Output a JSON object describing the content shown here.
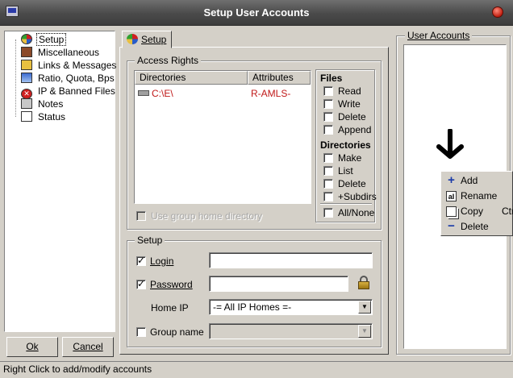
{
  "window": {
    "title": "Setup User Accounts"
  },
  "tree": {
    "items": [
      {
        "label": "Setup",
        "icon": "setup-icon",
        "color": "#2a5cc8"
      },
      {
        "label": "Miscellaneous",
        "icon": "book-icon",
        "color": "#8b4a2a"
      },
      {
        "label": "Links & Messages",
        "icon": "folder-icon",
        "color": "#e8c040"
      },
      {
        "label": "Ratio, Quota, Bps",
        "icon": "gauge-icon",
        "color": "#3a6ad0"
      },
      {
        "label": "IP & Banned Files",
        "icon": "ban-icon",
        "color": "#d02020"
      },
      {
        "label": "Notes",
        "icon": "notes-icon",
        "color": "#c8c8c8"
      },
      {
        "label": "Status",
        "icon": "status-icon",
        "color": "#ffffff"
      }
    ]
  },
  "buttons": {
    "ok": "Ok",
    "cancel": "Cancel"
  },
  "tab": {
    "label": "Setup"
  },
  "access_rights": {
    "label": "Access Rights",
    "columns": [
      "Directories",
      "Attributes"
    ],
    "rows": [
      {
        "directory": "C:\\E\\",
        "attributes": "R-AMLS-"
      }
    ],
    "use_group_home": "Use group home directory"
  },
  "files": {
    "label": "Files",
    "options": [
      {
        "label": "Read",
        "checked": false
      },
      {
        "label": "Write",
        "checked": false
      },
      {
        "label": "Delete",
        "checked": false
      },
      {
        "label": "Append",
        "checked": false
      }
    ]
  },
  "directories": {
    "label": "Directories",
    "options": [
      {
        "label": "Make",
        "checked": false
      },
      {
        "label": "List",
        "checked": false
      },
      {
        "label": "Delete",
        "checked": false
      },
      {
        "label": "+Subdirs",
        "checked": false
      }
    ],
    "all_none": "All/None"
  },
  "setup": {
    "label": "Setup",
    "login": {
      "label": "Login",
      "checked": true,
      "value": ""
    },
    "password": {
      "label": "Password",
      "checked": true,
      "value": ""
    },
    "home_ip": {
      "label": "Home IP",
      "value": "-= All IP Homes =-"
    },
    "group_name": {
      "label": "Group name",
      "checked": false,
      "value": ""
    }
  },
  "user_accounts": {
    "label": "User Accounts"
  },
  "context_menu": {
    "items": [
      {
        "label": "Add",
        "icon": "plus-icon",
        "shortcut": ""
      },
      {
        "label": "Rename",
        "icon": "rename-icon",
        "shortcut": ""
      },
      {
        "label": "Copy",
        "icon": "copy-icon",
        "shortcut": "Ctr"
      },
      {
        "label": "Delete",
        "icon": "minus-icon",
        "shortcut": ""
      }
    ]
  },
  "status": {
    "text": "Right Click to add/modify accounts"
  }
}
